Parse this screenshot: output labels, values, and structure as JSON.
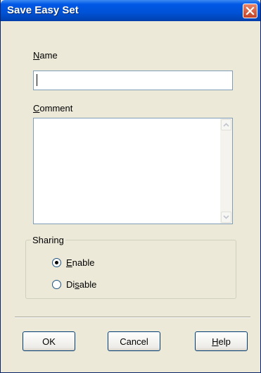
{
  "window": {
    "title": "Save Easy Set"
  },
  "name_field": {
    "label_mnemonic": "N",
    "label_rest": "ame",
    "value": ""
  },
  "comment_field": {
    "label_mnemonic": "C",
    "label_rest": "omment",
    "value": ""
  },
  "sharing": {
    "caption": "Sharing",
    "options": [
      {
        "pre": "",
        "mnemonic": "E",
        "post": "nable",
        "selected": true
      },
      {
        "pre": "Di",
        "mnemonic": "s",
        "post": "able",
        "selected": false
      }
    ]
  },
  "buttons": {
    "ok": "OK",
    "cancel": "Cancel",
    "help_mnemonic": "H",
    "help_rest": "elp"
  },
  "colors": {
    "title_bar": "#0054E3",
    "close_button": "#D9502F",
    "dialog_bg": "#ECE9D8",
    "radio_check": "#000000"
  },
  "icons": {
    "close": "close-x-icon",
    "scroll_up": "chevron-up-icon",
    "scroll_down": "chevron-down-icon"
  }
}
